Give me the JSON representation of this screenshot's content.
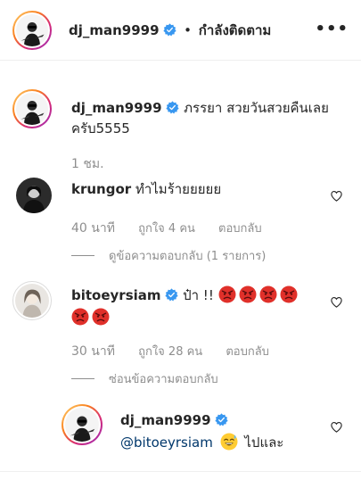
{
  "header": {
    "username": "dj_man9999",
    "separator": "•",
    "follow_label": "กำลังติดตาม",
    "more_label": "•••"
  },
  "caption": {
    "username": "dj_man9999",
    "text": "ภรรยา สวยวันสวยคืนเลยครับ5555",
    "time": "1 ชม."
  },
  "comments": [
    {
      "username": "krungor",
      "text": "ทำไมร้ายยยยย",
      "time": "40 นาที",
      "likes": "ถูกใจ 4 คน",
      "reply_label": "ตอบกลับ",
      "view_replies": "ดูข้อความตอบกลับ (1 รายการ)"
    },
    {
      "username": "bitoeyrsiam",
      "text": "ป๋า !!",
      "time": "30 นาที",
      "likes": "ถูกใจ 28 คน",
      "reply_label": "ตอบกลับ",
      "hide_replies": "ซ่อนข้อความตอบกลับ"
    }
  ],
  "reply": {
    "username": "dj_man9999",
    "mention": "@bitoeyrsiam",
    "text": "ไปและ"
  },
  "colors": {
    "verified": "#3897f0",
    "muted": "#8e8e8e",
    "mention": "#00376b"
  },
  "icons": [
    "verified-badge-icon",
    "heart-icon",
    "angry-face-emoji",
    "sweat-smile-emoji",
    "more-options-icon"
  ]
}
